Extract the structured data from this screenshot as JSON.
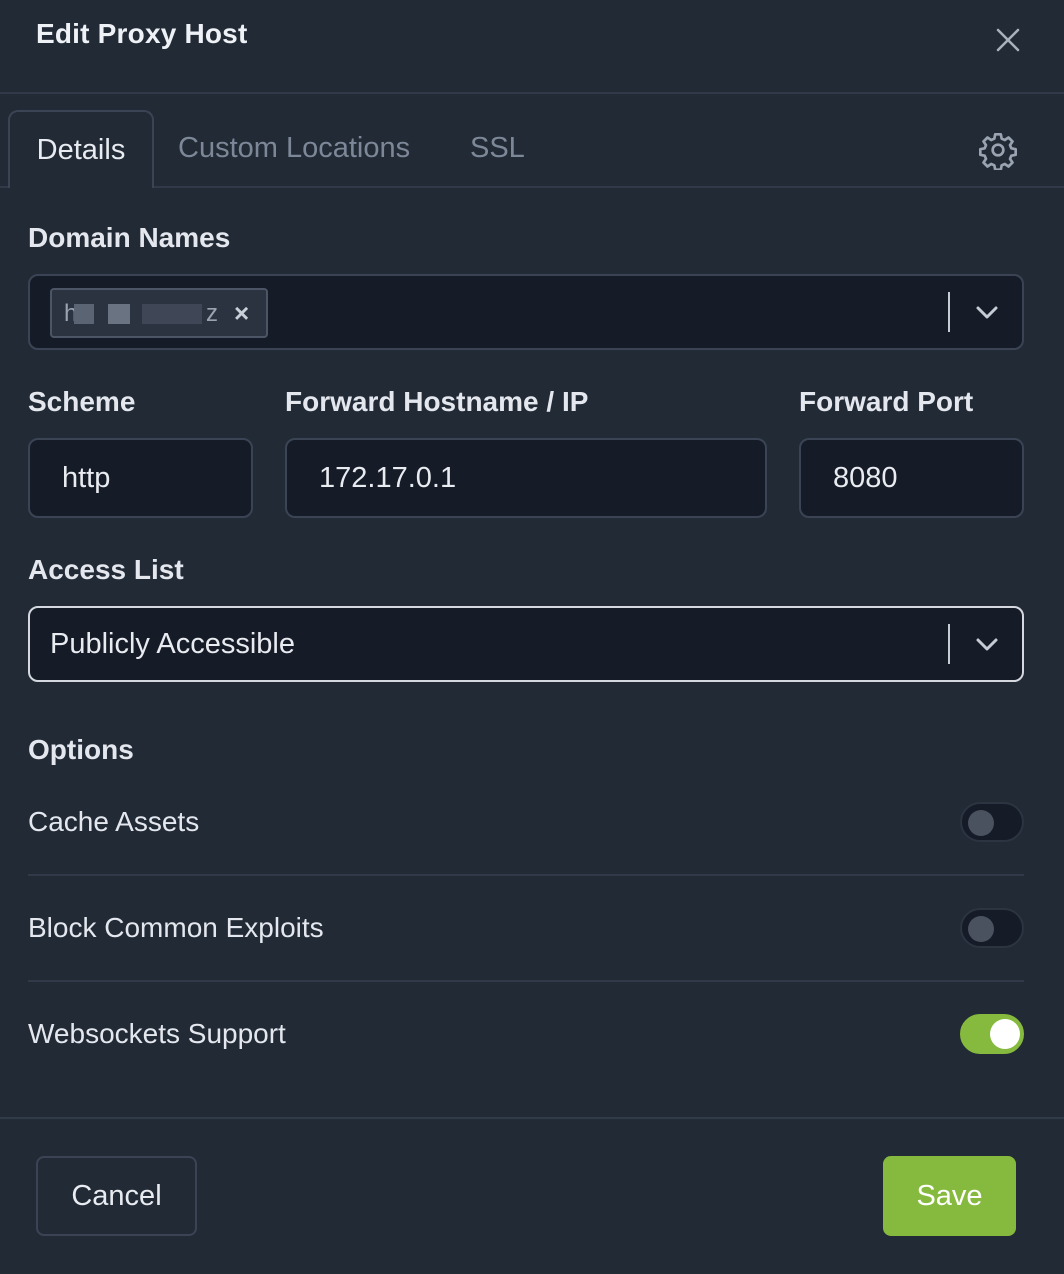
{
  "modal": {
    "title": "Edit Proxy Host"
  },
  "tabs": [
    {
      "label": "Details",
      "active": true
    },
    {
      "label": "Custom Locations",
      "active": false
    },
    {
      "label": "SSL",
      "active": false
    }
  ],
  "form": {
    "domain_names_label": "Domain Names",
    "domain_chip_start": "h",
    "domain_chip_end": "z",
    "scheme_label": "Scheme",
    "scheme_value": "http",
    "forward_host_label": "Forward Hostname / IP",
    "forward_host_value": "172.17.0.1",
    "forward_port_label": "Forward Port",
    "forward_port_value": "8080",
    "access_list_label": "Access List",
    "access_list_value": "Publicly Accessible"
  },
  "options": {
    "heading": "Options",
    "items": [
      {
        "label": "Cache Assets",
        "enabled": false
      },
      {
        "label": "Block Common Exploits",
        "enabled": false
      },
      {
        "label": "Websockets Support",
        "enabled": true
      }
    ]
  },
  "footer": {
    "cancel_label": "Cancel",
    "save_label": "Save"
  },
  "colors": {
    "accent": "#86ba3e",
    "background": "#222a36",
    "input_background": "#151b27"
  },
  "icons": {
    "close": "close-icon",
    "settings": "gear-icon",
    "dropdown": "chevron-down-icon",
    "remove_chip": "remove-chip-icon"
  }
}
